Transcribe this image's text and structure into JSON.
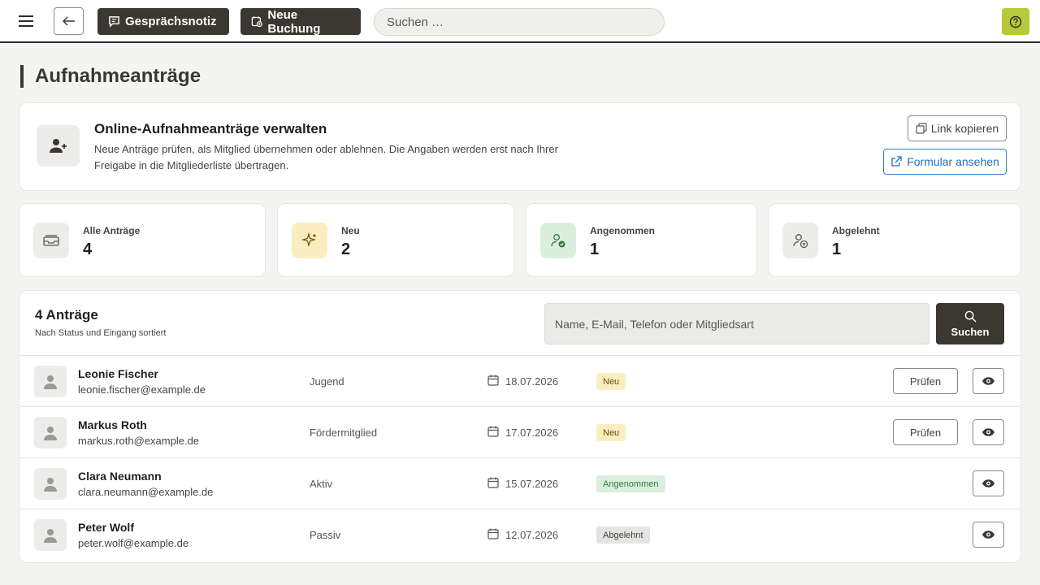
{
  "header": {
    "note_label": "Gesprächsnotiz",
    "booking_label": "Neue Buchung",
    "search_placeholder": "Suchen …",
    "accent_color": "#b6c93a"
  },
  "page": {
    "title": "Aufnahmeanträge"
  },
  "info": {
    "title": "Online-Aufnahmeanträge verwalten",
    "description": "Neue Anträge prüfen, als Mitglied übernehmen oder ablehnen. Die Angaben werden erst nach Ihrer Freigabe in die Mitgliederliste übertragen.",
    "copy_link_label": "Link kopieren",
    "view_form_label": "Formular ansehen"
  },
  "stats": [
    {
      "label": "Alle Anträge",
      "value": "4",
      "icon": "inbox-icon"
    },
    {
      "label": "Neu",
      "value": "2",
      "icon": "sparkle-icon"
    },
    {
      "label": "Angenommen",
      "value": "1",
      "icon": "user-check-icon"
    },
    {
      "label": "Abgelehnt",
      "value": "1",
      "icon": "user-x-icon"
    }
  ],
  "list": {
    "title": "4 Anträge",
    "subtitle": "Nach Status und Eingang sortiert",
    "search_placeholder": "Name, E-Mail, Telefon oder Mitgliedsart",
    "search_button": "Suchen",
    "check_label": "Prüfen",
    "rows": [
      {
        "name": "Leonie Fischer",
        "email": "leonie.fischer@example.de",
        "type": "Jugend",
        "date": "18.07.2026",
        "status": "Neu",
        "status_kind": "new"
      },
      {
        "name": "Markus Roth",
        "email": "markus.roth@example.de",
        "type": "Fördermitglied",
        "date": "17.07.2026",
        "status": "Neu",
        "status_kind": "new"
      },
      {
        "name": "Clara Neumann",
        "email": "clara.neumann@example.de",
        "type": "Aktiv",
        "date": "15.07.2026",
        "status": "Angenommen",
        "status_kind": "accepted"
      },
      {
        "name": "Peter Wolf",
        "email": "peter.wolf@example.de",
        "type": "Passiv",
        "date": "12.07.2026",
        "status": "Abgelehnt",
        "status_kind": "rejected"
      }
    ]
  }
}
